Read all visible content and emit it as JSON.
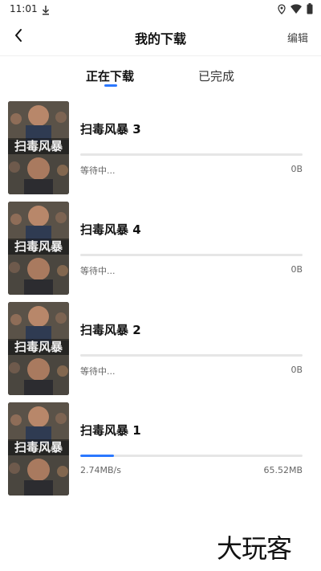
{
  "status_bar": {
    "time": "11:01"
  },
  "nav": {
    "title": "我的下载",
    "edit_label": "编辑"
  },
  "tabs": [
    {
      "label": "正在下载",
      "active": true
    },
    {
      "label": "已完成",
      "active": false
    }
  ],
  "poster_text": "扫毒风暴",
  "downloads": [
    {
      "title": "扫毒风暴 3",
      "status": "等待中...",
      "size": "0B",
      "progress": 0
    },
    {
      "title": "扫毒风暴 4",
      "status": "等待中...",
      "size": "0B",
      "progress": 0
    },
    {
      "title": "扫毒风暴 2",
      "status": "等待中...",
      "size": "0B",
      "progress": 0
    },
    {
      "title": "扫毒风暴 1",
      "status": "2.74MB/s",
      "size": "65.52MB",
      "progress": 0.15
    }
  ],
  "watermark": "大玩客",
  "colors": {
    "accent": "#2b78ff",
    "track": "#e6e6e6"
  }
}
